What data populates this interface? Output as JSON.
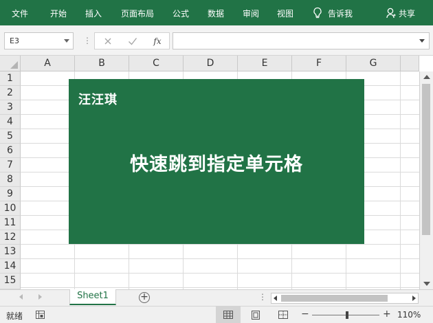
{
  "ribbon": {
    "tabs": [
      "文件",
      "开始",
      "插入",
      "页面布局",
      "公式",
      "数据",
      "审阅",
      "视图"
    ],
    "tell_me": "告诉我",
    "share": "共享",
    "icons": {
      "tell_me": "lightbulb-icon",
      "share": "person-icon"
    },
    "accent_color": "#217346"
  },
  "formula_bar": {
    "name_box": "E3",
    "fx_label": "fx",
    "formula_value": "",
    "icons": [
      "cancel-icon",
      "enter-icon",
      "insert-function-icon"
    ]
  },
  "grid": {
    "columns": [
      "A",
      "B",
      "C",
      "D",
      "E",
      "F",
      "G"
    ],
    "rows": [
      "1",
      "2",
      "3",
      "4",
      "5",
      "6",
      "7",
      "8",
      "9",
      "10",
      "11",
      "12",
      "13",
      "14",
      "15"
    ]
  },
  "banner": {
    "author": "汪汪琪",
    "headline": "快速跳到指定单元格",
    "color": "#217346"
  },
  "sheets": {
    "tabs": [
      "Sheet1"
    ],
    "active": "Sheet1",
    "add_label": "+"
  },
  "status": {
    "ready": "就绪",
    "zoom_minus": "−",
    "zoom_plus": "+",
    "zoom": "110%",
    "zoom_percent": 110
  }
}
